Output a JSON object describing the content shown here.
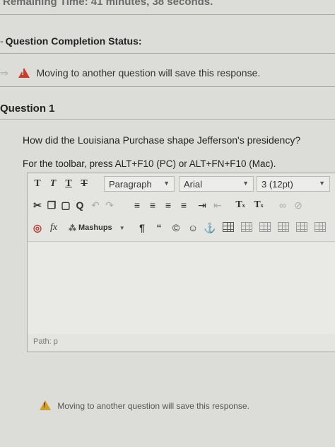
{
  "header": {
    "timer_text": "Remaining Time: 41 minutes, 38 seconds."
  },
  "status": {
    "heading": "Question Completion Status:",
    "warning": "Moving to another question will save this response."
  },
  "question": {
    "title": "Question 1",
    "text": "How did the Louisiana Purchase shape Jefferson's presidency?",
    "toolbar_help": "For the toolbar, press ALT+F10 (PC) or ALT+FN+F10 (Mac)."
  },
  "editor": {
    "row1": {
      "bold": "T",
      "italic": "T",
      "underline": "T",
      "strike": "T",
      "paragraph": "Paragraph",
      "font": "Arial",
      "size": "3 (12pt)"
    },
    "row2": {
      "superscript": "T",
      "subscript": "T"
    },
    "row3": {
      "fx": "fx",
      "mashups": "Mashups",
      "pilcrow": "¶",
      "quote": "“",
      "copyright": "©"
    },
    "path_label": "Path: p"
  },
  "footer": {
    "warning": "Moving to another question will save this response."
  }
}
